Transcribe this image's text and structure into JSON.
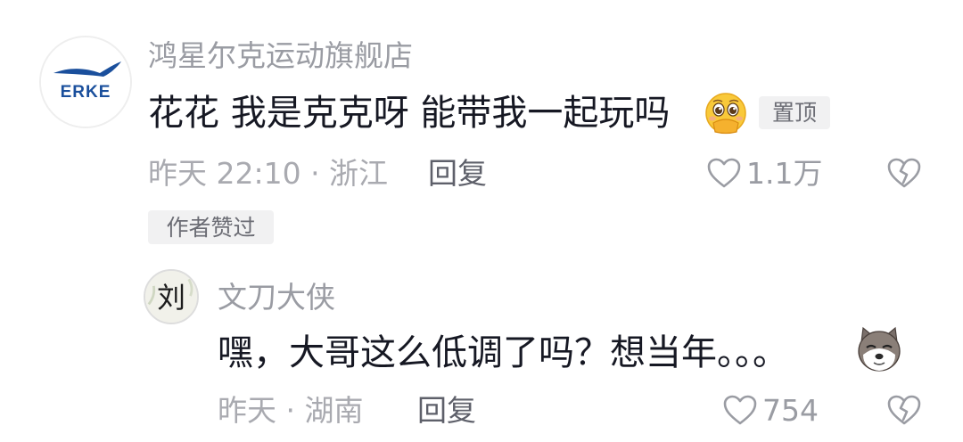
{
  "top_comment": {
    "avatar": {
      "logo_text": "ERKE",
      "icon": "erke-brand-logo"
    },
    "username": "鸿星尔克运动旗舰店",
    "text": "花花 我是克克呀  能带我一起玩吗",
    "emoji": "pleading-face-emoji",
    "pinned_label": "置顶",
    "time_location": "昨天 22:10 · 浙江",
    "reply_label": "回复",
    "like_count": "1.1万",
    "author_liked_label": "作者赞过"
  },
  "reply_comment": {
    "avatar": {
      "char": "刘",
      "icon": "calligraphy-avatar"
    },
    "username": "文刀大侠",
    "text": "嘿，大哥这么低调了吗？想当年。。。",
    "emoji": "doge-emoji",
    "time_location": "昨天 · 湖南",
    "reply_label": "回复",
    "like_count": "754"
  },
  "colors": {
    "primary_text": "#161823",
    "secondary_text": "#9a9ca3",
    "badge_bg": "#f1f1f2",
    "brand_blue": "#1a4f9c"
  }
}
